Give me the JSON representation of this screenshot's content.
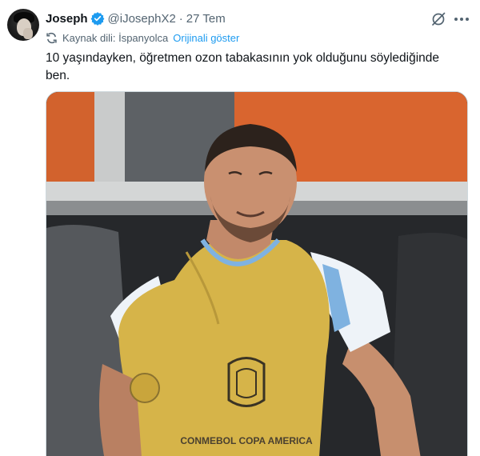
{
  "tweet": {
    "display_name": "Joseph",
    "handle": "@iJosephX2",
    "separator": "·",
    "date": "27 Tem",
    "translation": {
      "source_label": "Kaynak dili: İspanyolca",
      "show_original": "Orijinali göster"
    },
    "text": "10 yaşındayken, öğretmen ozon tabakasının yok olduğunu söylediğinde ben.",
    "media": {
      "jersey_text": "CONMEBOL COPA AMERICA"
    }
  },
  "icons": {
    "avatar": "avatar",
    "verified": "verified-badge-icon",
    "grok": "grok-icon",
    "more": "more-icon",
    "translate": "translate-icon"
  },
  "colors": {
    "accent": "#1d9bf0",
    "secondary_text": "#536471",
    "primary_text": "#0f1419",
    "bib": "#d8b64a",
    "wall": "#d8642f"
  }
}
